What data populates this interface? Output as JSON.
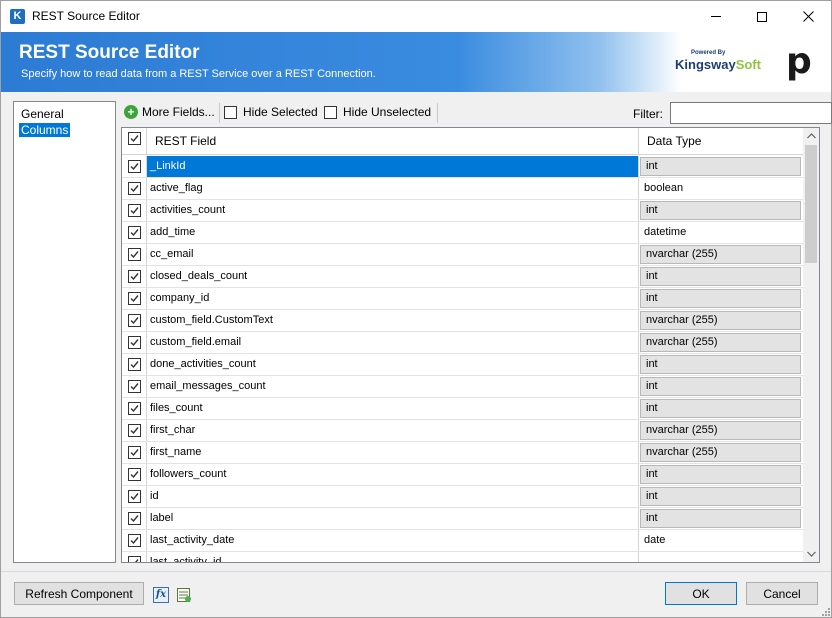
{
  "window": {
    "title": "REST Source Editor",
    "app_icon_letter": "K"
  },
  "banner": {
    "title": "REST Source Editor",
    "subtitle": "Specify how to read data from a REST Service over a REST Connection.",
    "logo_powered": "Powered By",
    "logo_name_a": "Kingsway",
    "logo_name_b": "Soft",
    "partner_logo": "p"
  },
  "nav": {
    "items": [
      {
        "label": "General",
        "selected": false
      },
      {
        "label": "Columns",
        "selected": true
      }
    ]
  },
  "toolbar": {
    "more_fields": "More Fields...",
    "hide_selected": "Hide Selected",
    "hide_unselected": "Hide Unselected",
    "filter_label": "Filter:",
    "filter_value": ""
  },
  "grid": {
    "columns": [
      "REST Field",
      "Data Type"
    ],
    "header_checked": true,
    "rows": [
      {
        "field": "_LinkId",
        "type": "int",
        "checked": true,
        "editable_type": false,
        "selected": true
      },
      {
        "field": "active_flag",
        "type": "boolean",
        "checked": true,
        "editable_type": true,
        "selected": false
      },
      {
        "field": "activities_count",
        "type": "int",
        "checked": true,
        "editable_type": false,
        "selected": false
      },
      {
        "field": "add_time",
        "type": "datetime",
        "checked": true,
        "editable_type": true,
        "selected": false
      },
      {
        "field": "cc_email",
        "type": "nvarchar (255)",
        "checked": true,
        "editable_type": false,
        "selected": false
      },
      {
        "field": "closed_deals_count",
        "type": "int",
        "checked": true,
        "editable_type": false,
        "selected": false
      },
      {
        "field": "company_id",
        "type": "int",
        "checked": true,
        "editable_type": false,
        "selected": false
      },
      {
        "field": "custom_field.CustomText",
        "type": "nvarchar (255)",
        "checked": true,
        "editable_type": false,
        "selected": false
      },
      {
        "field": "custom_field.email",
        "type": "nvarchar (255)",
        "checked": true,
        "editable_type": false,
        "selected": false
      },
      {
        "field": "done_activities_count",
        "type": "int",
        "checked": true,
        "editable_type": false,
        "selected": false
      },
      {
        "field": "email_messages_count",
        "type": "int",
        "checked": true,
        "editable_type": false,
        "selected": false
      },
      {
        "field": "files_count",
        "type": "int",
        "checked": true,
        "editable_type": false,
        "selected": false
      },
      {
        "field": "first_char",
        "type": "nvarchar (255)",
        "checked": true,
        "editable_type": false,
        "selected": false
      },
      {
        "field": "first_name",
        "type": "nvarchar (255)",
        "checked": true,
        "editable_type": false,
        "selected": false
      },
      {
        "field": "followers_count",
        "type": "int",
        "checked": true,
        "editable_type": false,
        "selected": false
      },
      {
        "field": "id",
        "type": "int",
        "checked": true,
        "editable_type": false,
        "selected": false
      },
      {
        "field": "label",
        "type": "int",
        "checked": true,
        "editable_type": false,
        "selected": false
      },
      {
        "field": "last_activity_date",
        "type": "date",
        "checked": true,
        "editable_type": true,
        "selected": false
      },
      {
        "field": "last_activity_id",
        "type": "",
        "checked": true,
        "editable_type": true,
        "selected": false
      }
    ]
  },
  "footer": {
    "refresh_label": "Refresh Component",
    "ok_label": "OK",
    "cancel_label": "Cancel"
  }
}
